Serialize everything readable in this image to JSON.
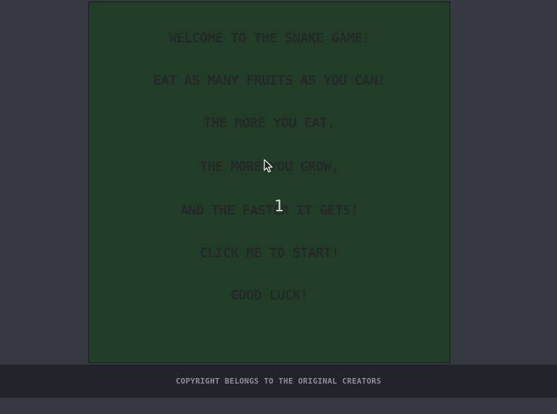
{
  "intro": {
    "lines": [
      "WELCOME TO THE SNAKE GAME!",
      "EAT AS MANY FRUITS AS YOU CAN!",
      "THE MORE YOU EAT,",
      "THE MORE YOU GROW,",
      "AND THE FASTER IT GETS!",
      "CLICK ME TO START!",
      "GOOD LUCK!"
    ]
  },
  "score": "1",
  "footer": {
    "text": "COPYRIGHT BELONGS TO THE ORIGINAL CREATORS"
  },
  "colors": {
    "page_bg": "#363942",
    "board_bg": "#213d27",
    "text_dark": "#25292a",
    "footer_bg": "#22242c",
    "footer_text": "#8b8f97",
    "score_text": "#cfe0c5"
  }
}
